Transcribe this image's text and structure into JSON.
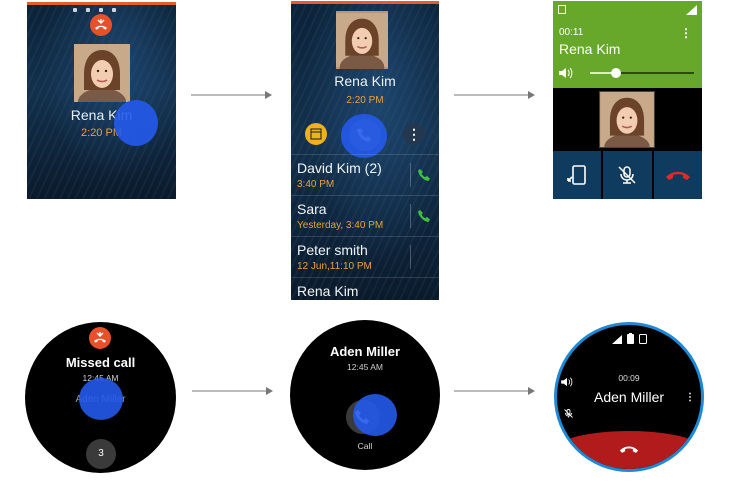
{
  "screen1": {
    "contact_name": "Rena Kim",
    "time": "2:20 PM"
  },
  "screen2": {
    "contact_name": "Rena Kim",
    "time": "2:20 PM",
    "more_label": "⋮",
    "log": [
      {
        "name": "David Kim (2)",
        "time": "3:40 PM"
      },
      {
        "name": "Sara",
        "time": "Yesterday, 3:40 PM"
      },
      {
        "name": "Peter smith",
        "time": "12 Jun,11:10 PM"
      },
      {
        "name": "Rena Kim",
        "time": ""
      }
    ]
  },
  "screen3": {
    "duration": "00:11",
    "contact_name": "Rena Kim",
    "more_label": "⋮",
    "volume_level": 0.25
  },
  "watch_missed": {
    "title": "Missed call",
    "time": "12:45 AM",
    "contact_name": "Aden Miller",
    "count": "3"
  },
  "watch_callback": {
    "contact_name": "Aden Miller",
    "time": "12:45 AM",
    "call_label": "Call"
  },
  "watch_in_call": {
    "duration": "00:09",
    "contact_name": "Aden Miller",
    "more_label": "⋮"
  },
  "colors": {
    "accent_orange": "#e85b2a",
    "time_amber": "#e8a23a",
    "touch_blue": "#235aeb",
    "call_green": "#67a82a",
    "end_red": "#b11b1b"
  },
  "icons": [
    "missed-call-icon",
    "calendar-icon",
    "phone-icon",
    "more-icon",
    "sim-icon",
    "signal-icon",
    "volume-icon",
    "transfer-to-phone-icon",
    "mute-mic-icon",
    "end-call-icon",
    "battery-icon"
  ]
}
